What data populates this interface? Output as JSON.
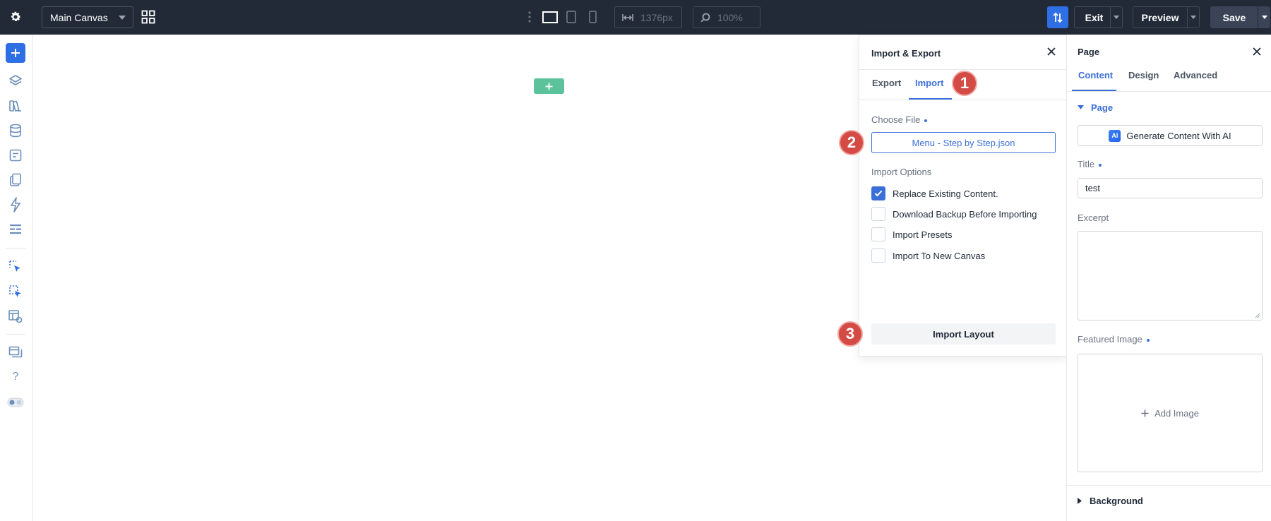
{
  "topbar": {
    "canvas_select": "Main Canvas",
    "width_value": "1376px",
    "zoom_value": "100%",
    "exit_label": "Exit",
    "preview_label": "Preview",
    "save_label": "Save"
  },
  "import_export": {
    "title": "Import & Export",
    "tabs": [
      {
        "label": "Export"
      },
      {
        "label": "Import",
        "active": true
      }
    ],
    "choose_file_label": "Choose File",
    "file_button": "Menu - Step by Step.json",
    "options_label": "Import Options",
    "options": [
      {
        "label": "Replace Existing Content.",
        "checked": true
      },
      {
        "label": "Download Backup Before Importing",
        "checked": false
      },
      {
        "label": "Import Presets",
        "checked": false
      },
      {
        "label": "Import To New Canvas",
        "checked": false
      }
    ],
    "import_button": "Import Layout"
  },
  "badges": [
    "1",
    "2",
    "3"
  ],
  "page_panel": {
    "title": "Page",
    "tabs": [
      {
        "label": "Content",
        "active": true
      },
      {
        "label": "Design"
      },
      {
        "label": "Advanced"
      }
    ],
    "section_title": "Page",
    "ai_badge": "AI",
    "ai_button": "Generate Content With AI",
    "title_label": "Title",
    "title_value": "test",
    "excerpt_label": "Excerpt",
    "featured_label": "Featured Image",
    "add_image": "Add Image",
    "background_section": "Background"
  },
  "colors": {
    "accent": "#3b6fd8",
    "topbar_bg": "#222a38",
    "badge": "#d44b45",
    "canvas_add": "#5cc29c"
  }
}
